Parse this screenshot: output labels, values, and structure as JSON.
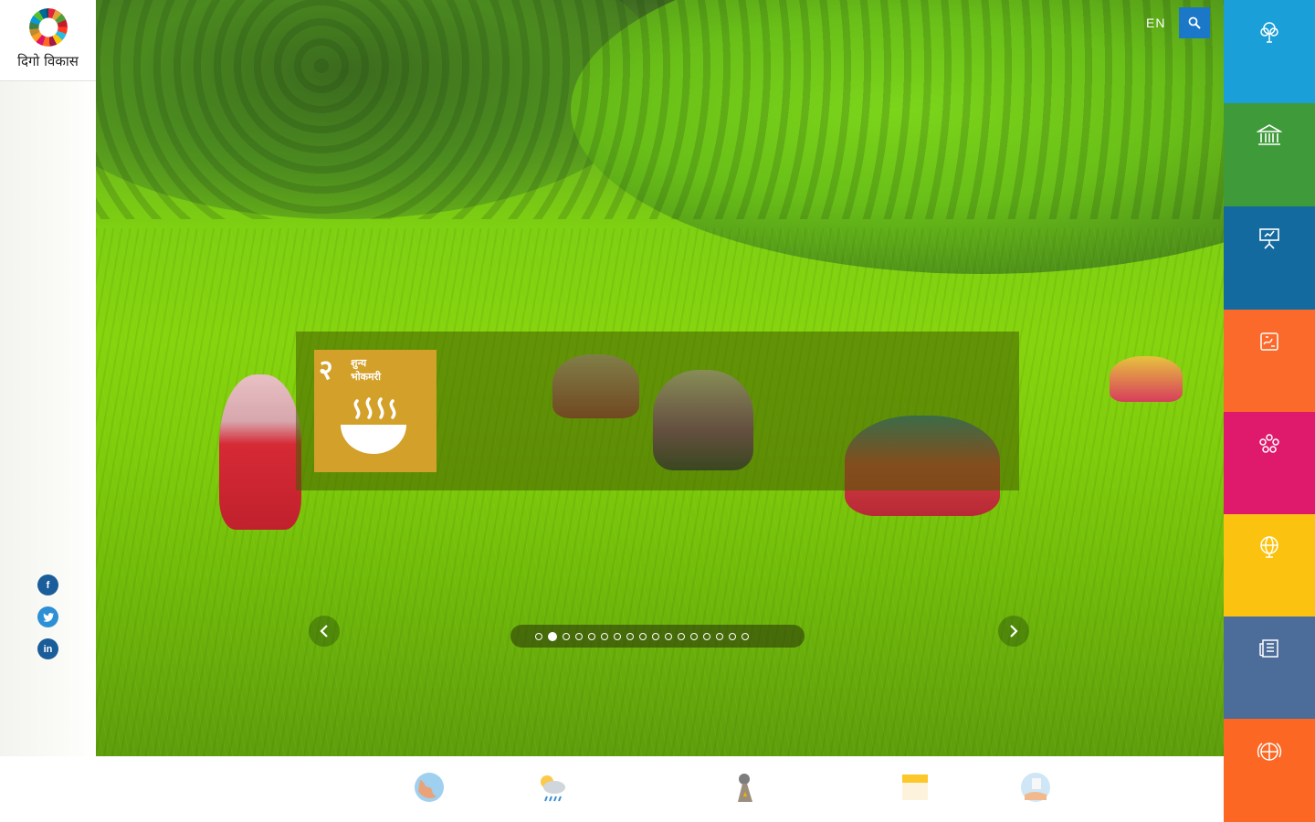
{
  "logo": {
    "text": "दिगो विकास"
  },
  "header": {
    "language": "EN"
  },
  "slide": {
    "goal_number": "२",
    "goal_title_line1": "शुन्य",
    "goal_title_line2": "भोकमरी",
    "goal_color": "#d3a029",
    "goal_icon": "bowl-icon"
  },
  "carousel": {
    "total_slides": 17,
    "active_index": 1
  },
  "social": [
    {
      "name": "facebook-icon",
      "glyph": "f"
    },
    {
      "name": "twitter-icon",
      "glyph": "t"
    },
    {
      "name": "linkedin-icon",
      "glyph": "in"
    }
  ],
  "right_nav": [
    {
      "icon": "tree-icon",
      "color": "#1a9fd8"
    },
    {
      "icon": "government-building-icon",
      "color": "#3f9a3a"
    },
    {
      "icon": "presentation-board-icon",
      "color": "#136a9f"
    },
    {
      "icon": "map-icon",
      "color": "#fb6a2b"
    },
    {
      "icon": "network-icon",
      "color": "#df1a6d"
    },
    {
      "icon": "globe-icon",
      "color": "#fbc30f"
    },
    {
      "icon": "newspaper-icon",
      "color": "#4c6c9a"
    },
    {
      "icon": "un-emblem-icon",
      "color": "#fc6724"
    }
  ],
  "bottom_icons": [
    "earth-icon",
    "weather-icon",
    "volcano-icon",
    "notes-icon",
    "map-hand-icon"
  ]
}
